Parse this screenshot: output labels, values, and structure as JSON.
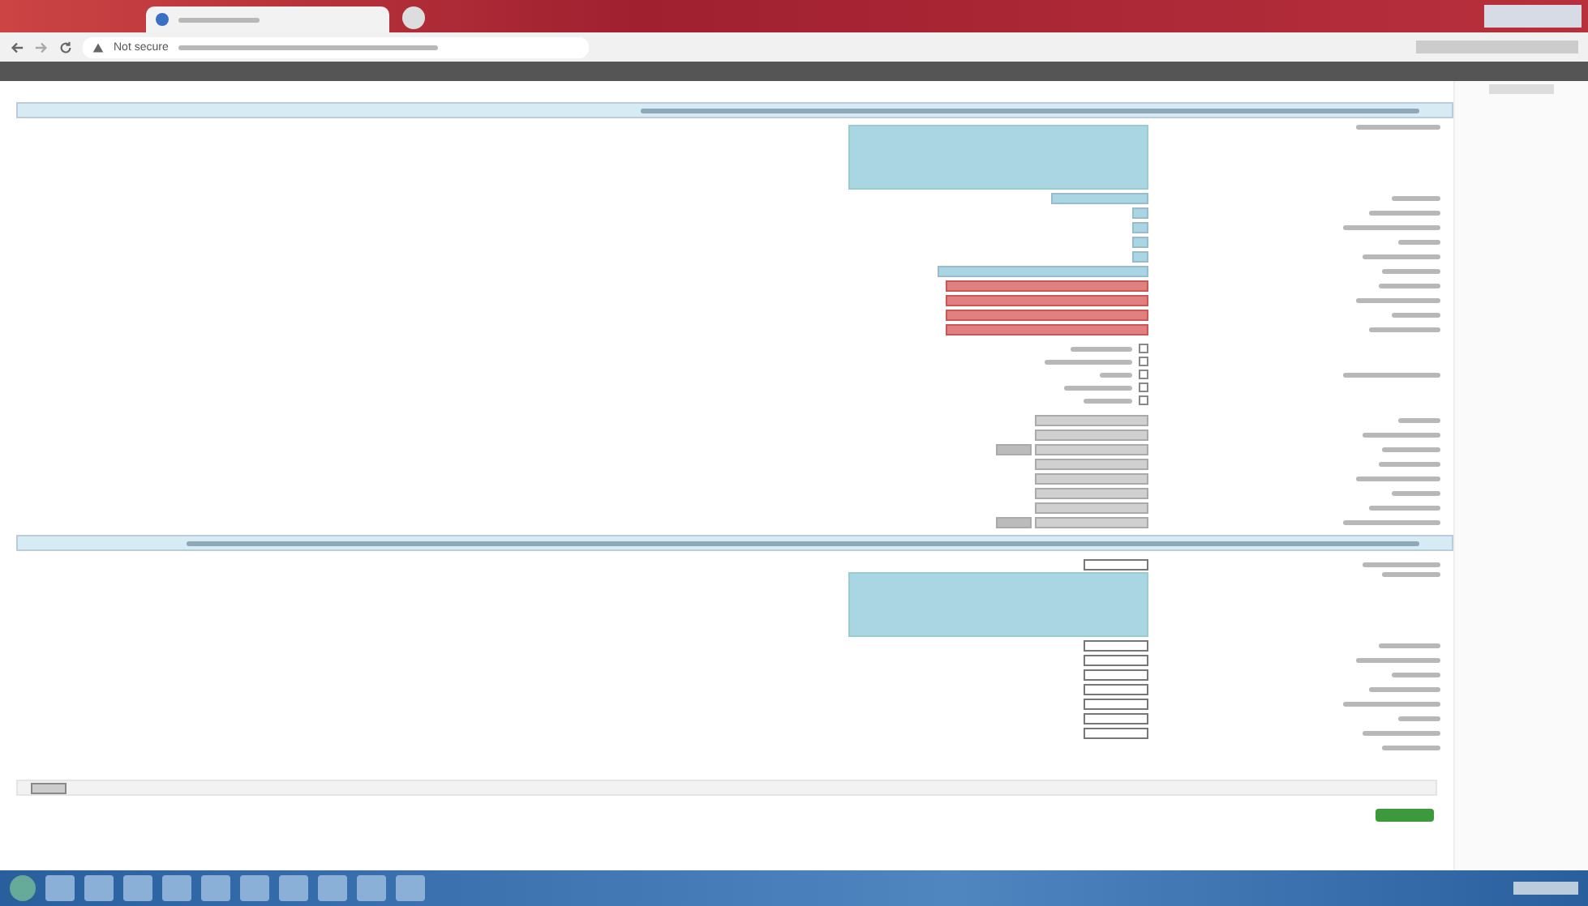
{
  "browser": {
    "security_warning": "Not secure"
  },
  "form": {
    "rows": [
      {
        "kind": "info"
      },
      {
        "kind": "area"
      },
      {
        "kind": "short"
      },
      {
        "kind": "tiny"
      },
      {
        "kind": "tiny"
      },
      {
        "kind": "tiny"
      },
      {
        "kind": "tiny"
      },
      {
        "kind": "wide"
      },
      {
        "kind": "error"
      },
      {
        "kind": "error"
      },
      {
        "kind": "error"
      },
      {
        "kind": "error"
      },
      {
        "kind": "checks",
        "options": [
          {
            "checked": false
          },
          {
            "checked": false
          },
          {
            "checked": false
          },
          {
            "checked": false
          },
          {
            "checked": false
          }
        ]
      },
      {
        "kind": "grey"
      },
      {
        "kind": "grey"
      },
      {
        "kind": "grey",
        "extra": true
      },
      {
        "kind": "grey"
      },
      {
        "kind": "grey"
      },
      {
        "kind": "grey"
      },
      {
        "kind": "grey"
      },
      {
        "kind": "grey",
        "extra": true
      },
      {
        "kind": "info"
      },
      {
        "kind": "input"
      },
      {
        "kind": "area"
      },
      {
        "kind": "input"
      },
      {
        "kind": "input"
      },
      {
        "kind": "input"
      },
      {
        "kind": "input"
      },
      {
        "kind": "input"
      },
      {
        "kind": "input"
      },
      {
        "kind": "input"
      },
      {
        "kind": "label"
      }
    ]
  }
}
